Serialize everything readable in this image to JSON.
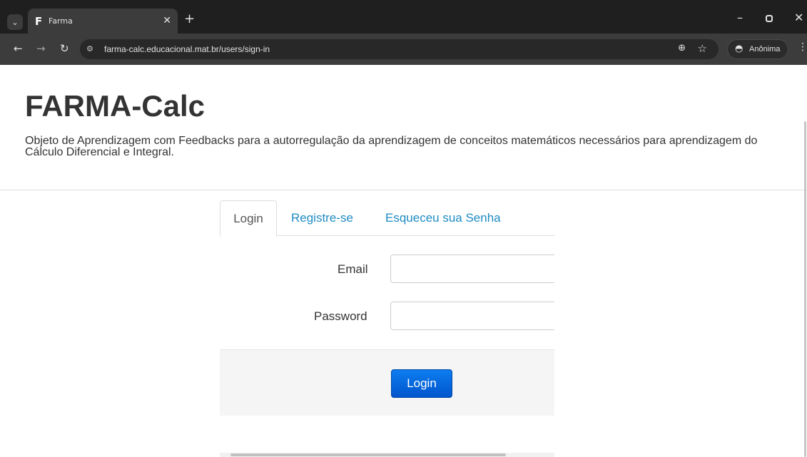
{
  "browser": {
    "tab_title": "Farma",
    "tab_favicon": "F",
    "url": "farma-calc.educacional.mat.br/users/sign-in",
    "incognito_label": "Anônima",
    "icons": [
      "tab-search-icon",
      "close-icon",
      "new-tab-icon",
      "minimize-icon",
      "restore-icon",
      "window-close-icon",
      "back-icon",
      "forward-icon",
      "reload-icon",
      "site-info-icon",
      "zoom-icon",
      "star-icon",
      "incognito-icon",
      "menu-icon"
    ]
  },
  "page": {
    "title": "FARMA-Calc",
    "description": "Objeto de Aprendizagem com Feedbacks para a autorregulação da aprendizagem de conceitos matemáticos necessários para aprendizagem do Cálculo Diferencial e Integral."
  },
  "tabs": {
    "login": "Login",
    "register": "Registre-se",
    "forgot": "Esqueceu sua Senha"
  },
  "form": {
    "email_label": "Email",
    "email_value": "",
    "password_label": "Password",
    "password_value": "",
    "submit_label": "Login"
  },
  "colors": {
    "link": "#1e8bc3",
    "button": "#0066dd",
    "title": "#333333"
  }
}
